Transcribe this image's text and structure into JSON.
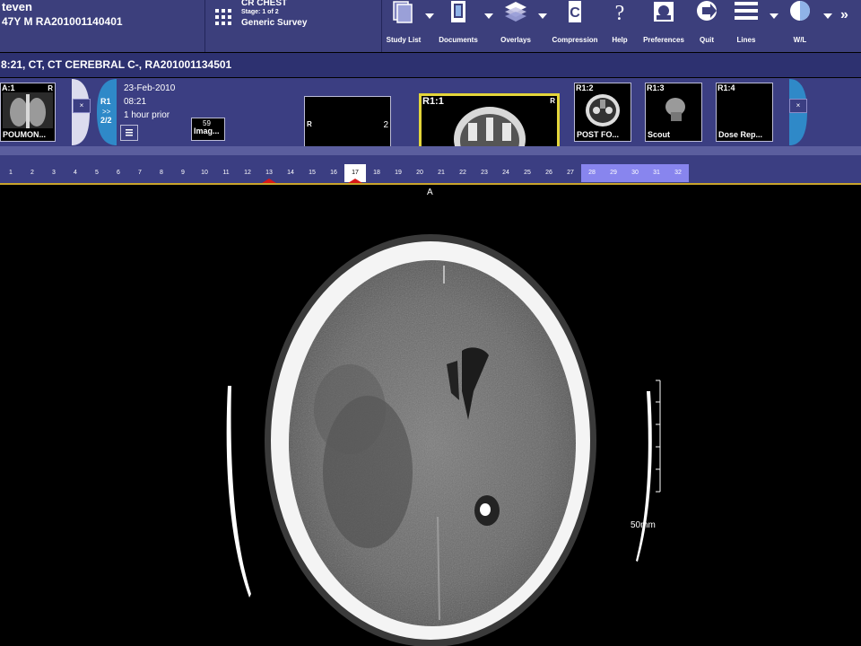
{
  "header": {
    "patient_name": "teven",
    "patient_info": "47Y M RA201001140401",
    "study_title": "CR CHEST",
    "study_stage": "Stage: 1 of 2",
    "study_desc": "Generic Survey"
  },
  "toolbar": [
    {
      "label": "Study List",
      "icon": "study-list-icon"
    },
    {
      "label": "Documents",
      "icon": "documents-icon"
    },
    {
      "label": "Overlays",
      "icon": "overlays-icon"
    },
    {
      "label": "Compression",
      "icon": "compression-icon"
    },
    {
      "label": "Help",
      "icon": "help-icon"
    },
    {
      "label": "Preferences",
      "icon": "preferences-icon"
    },
    {
      "label": "Quit",
      "icon": "quit-icon"
    },
    {
      "label": "Lines",
      "icon": "lines-icon"
    },
    {
      "label": "W/L",
      "icon": "window-level-icon"
    }
  ],
  "more_symbol": "»",
  "series_title": "8:21, CT, CT CEREBRAL C-, RA201001134501",
  "thumbs": {
    "a1": {
      "top": "A:1",
      "bottom": "POUMON..."
    },
    "r1_label": "R1",
    "r1_nav": ">>",
    "r1_count": "2/2",
    "date": "23-Feb-2010",
    "time": "08:21",
    "prior": "1 hour prior",
    "image_count": "59",
    "image_label": "Imag...",
    "series2_number": "2",
    "r11": {
      "top": "R1:1"
    },
    "r12": {
      "top": "R1:2",
      "bottom": "POST FO..."
    },
    "r13": {
      "top": "R1:3",
      "bottom": "Scout"
    },
    "r14": {
      "top": "R1:4",
      "bottom": "Dose Rep..."
    },
    "close_symbol": "×"
  },
  "image_numbers": [
    "1",
    "2",
    "3",
    "4",
    "5",
    "6",
    "7",
    "8",
    "9",
    "10",
    "11",
    "12",
    "13",
    "14",
    "15",
    "16",
    "17",
    "18",
    "19",
    "20",
    "21",
    "22",
    "23",
    "24",
    "25",
    "26",
    "27",
    "28",
    "29",
    "30",
    "31",
    "32"
  ],
  "selected_image": "17",
  "marked_images": [
    "13",
    "17"
  ],
  "highlighted_images": [
    "28",
    "29",
    "30",
    "31",
    "32"
  ],
  "viewer": {
    "orientation_top": "A",
    "scale_label": "50mm"
  },
  "colors": {
    "header_bg": "#3c3f7c",
    "strip_bg": "#3b3e82",
    "highlight": "#8885ee",
    "accent_gold": "#c9a42c",
    "marker_red": "#d81818"
  }
}
